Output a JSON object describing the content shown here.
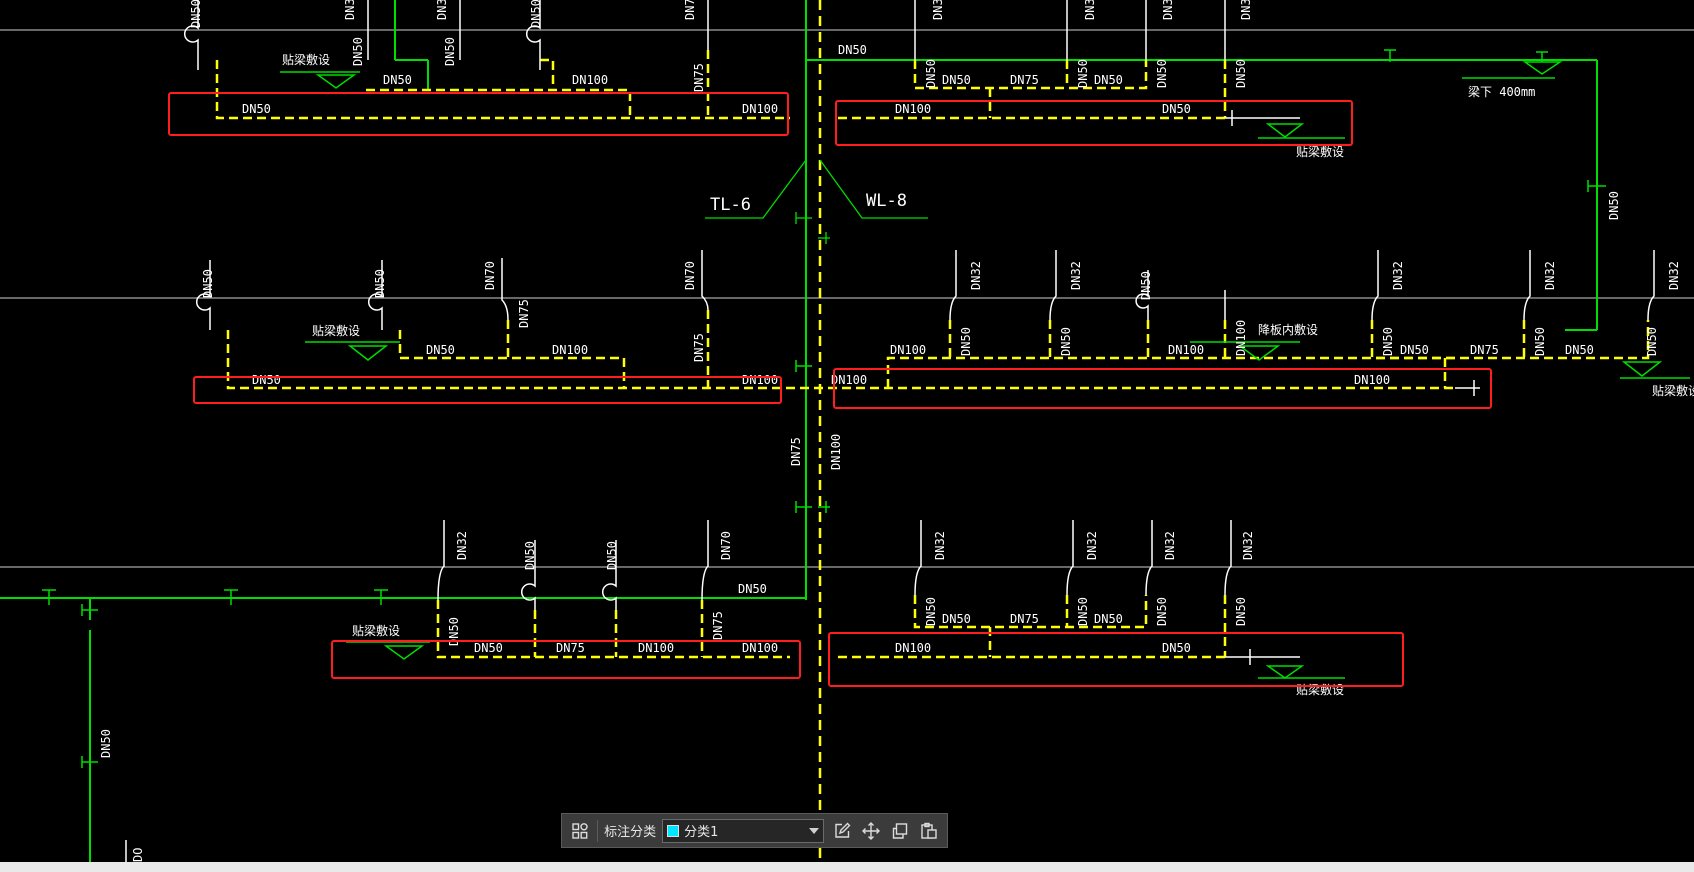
{
  "colors": {
    "background": "#000000",
    "pipe_yellow": "#ffff00",
    "pipe_green": "#00dd00",
    "frame_red": "#ff1e1e",
    "axis_white": "#ffffff",
    "category_swatch": "#00e5ff"
  },
  "labels": {
    "dn32": "DN32",
    "dn50": "DN50",
    "dn70": "DN70",
    "dn75": "DN75",
    "dn100": "DN100",
    "dn30_cut": "DN3",
    "dn7_cut": "DN7",
    "dn70_cut": "DO",
    "tl6": "TL-6",
    "wl8": "WL-8",
    "beam_embed": "贴梁敷设",
    "under_beam": "梁下 400mm",
    "slab_embed": "降板内敷设"
  },
  "toolbar": {
    "grid_icon": "grid-icon",
    "category_label": "标注分类",
    "category_value": "分类1",
    "edit_icon": "edit-icon",
    "move_icon": "move-icon",
    "copy_icon": "copy-icon",
    "paste_icon": "paste-icon"
  }
}
